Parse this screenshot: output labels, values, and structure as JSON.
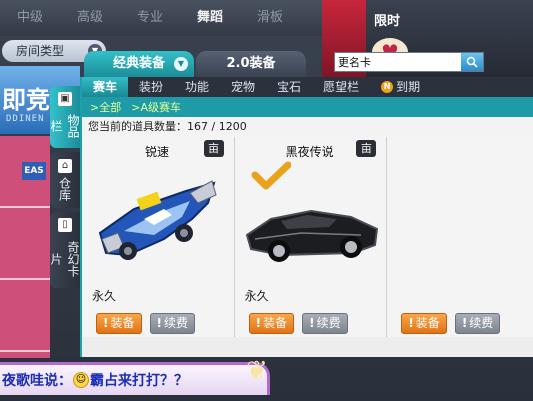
{
  "top_tabs": [
    "中级",
    "高级",
    "专业",
    "舞蹈",
    "滑板"
  ],
  "top_tabs_active": "舞蹈",
  "room_type_label": "房间类型",
  "left_banner": {
    "big": "即竞",
    "sub": "DDINEN"
  },
  "limit_panel_title": "限时",
  "rename_input": {
    "value": "更名卡"
  },
  "main_tabs": [
    {
      "label": "经典装备",
      "active": true
    },
    {
      "label": "2.0装备",
      "active": false
    }
  ],
  "side_tabs": [
    {
      "label": "物品栏",
      "active": true
    },
    {
      "label": "仓库",
      "active": false
    },
    {
      "label": "奇幻卡片",
      "active": false
    }
  ],
  "menu": [
    {
      "label": "赛车",
      "active": true
    },
    {
      "label": "装扮",
      "active": false
    },
    {
      "label": "功能",
      "active": false
    },
    {
      "label": "宠物",
      "active": false
    },
    {
      "label": "宝石",
      "active": false
    },
    {
      "label": "愿望栏",
      "active": false
    },
    {
      "label": "到期",
      "active": false,
      "badge": "N"
    }
  ],
  "breadcrumb": {
    "all": "全部",
    "sub": "A级赛车"
  },
  "item_count_text": "您当前的道具数量：167 / 1200",
  "items": [
    {
      "name": "锐速",
      "duration": "永久",
      "equip_label": "装备",
      "renew_label": "续费",
      "info": "亩",
      "checked": false
    },
    {
      "name": "黑夜传说",
      "duration": "永久",
      "equip_label": "装备",
      "renew_label": "续费",
      "info": "亩",
      "checked": true
    },
    {
      "name": "",
      "duration": "",
      "equip_label": "装备",
      "renew_label": "续费",
      "info": "",
      "checked": false
    }
  ],
  "chat": {
    "speaker": "夜歌哇说：",
    "message": "霸占来打打？？"
  },
  "colors": {
    "accent": "#1aa2ad",
    "equip": "#e9841f",
    "renew": "#8a919a",
    "chat_text": "#1a2fb4"
  }
}
